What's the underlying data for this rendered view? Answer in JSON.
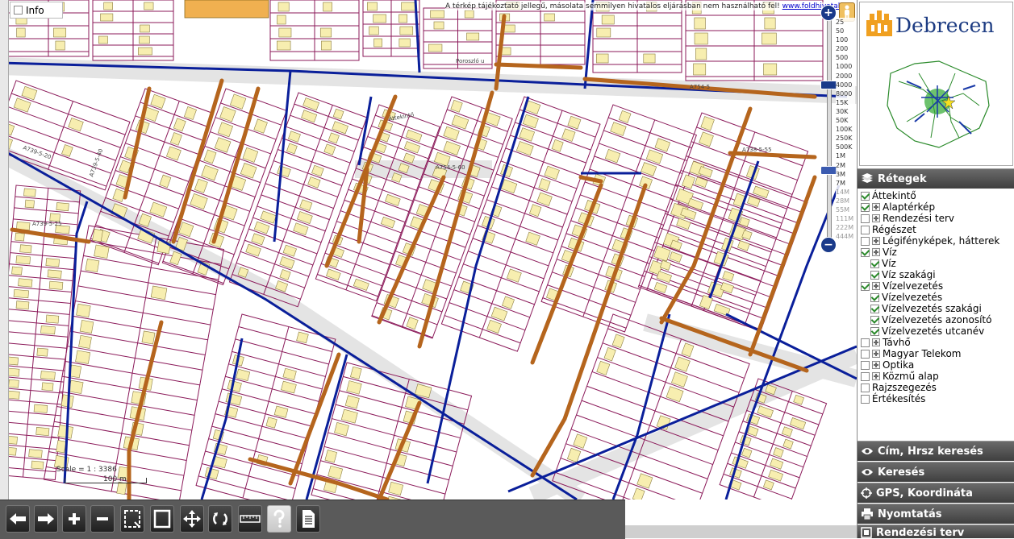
{
  "info": {
    "label": "Info",
    "checked": false
  },
  "disclaimer": {
    "text": "A térkép tájékoztató jellegű, másolata semmilyen hivatalos eljárásban nem használható fel!",
    "link": "www.foldhivatal.hu"
  },
  "zoom": {
    "plus": "+",
    "minus": "−"
  },
  "scales": [
    "25",
    "50",
    "100",
    "200",
    "500",
    "1000",
    "2000",
    "4000",
    "8000",
    "15K",
    "30K",
    "50K",
    "100K",
    "250K",
    "500K",
    "1M",
    "2M",
    "3M",
    "7M",
    "14M",
    "28M",
    "55M",
    "111M",
    "222M",
    "444M"
  ],
  "scale_bar": {
    "ratio": "Scale = 1 : 3386",
    "distance": "100 m"
  },
  "map_labels": [
    "Áttekintő",
    "Poroszló u",
    "A754-5",
    "A754-5-60",
    "A739-5-20",
    "A738-5-55",
    "A739-5-40",
    "A739-5-25"
  ],
  "toolbar": {
    "buttons": [
      "back-arrow-icon",
      "forward-arrow-icon",
      "zoom-in-icon",
      "zoom-out-icon",
      "zoom-box-icon",
      "full-extent-icon",
      "pan-icon",
      "refresh-icon",
      "measure-icon",
      "help-icon",
      "document-icon"
    ]
  },
  "logo": {
    "text": "Debrecen"
  },
  "panel": {
    "layers_header": "Rétegek",
    "address_search": "Cím, Hrsz keresés",
    "search": "Keresés",
    "gps": "GPS, Koordináta",
    "print": "Nyomtatás",
    "zoning": "Rendezési terv"
  },
  "layers": [
    {
      "label": "Áttekintő",
      "level": 0,
      "checkbox": true,
      "checked": true,
      "expand": false
    },
    {
      "label": "Alaptérkép",
      "level": 0,
      "checkbox": true,
      "checked": true,
      "expand": true
    },
    {
      "label": "Rendezési terv",
      "level": 0,
      "checkbox": true,
      "checked": false,
      "expand": true
    },
    {
      "label": "Régészet",
      "level": 0,
      "checkbox": true,
      "checked": false,
      "expand": false
    },
    {
      "label": "Légifényképek, hátterek",
      "level": 0,
      "checkbox": true,
      "checked": false,
      "expand": true
    },
    {
      "label": "Víz",
      "level": 0,
      "checkbox": true,
      "checked": true,
      "expand": true
    },
    {
      "label": "Víz",
      "level": 1,
      "checkbox": true,
      "checked": true,
      "expand": false
    },
    {
      "label": "Víz szakági",
      "level": 1,
      "checkbox": true,
      "checked": true,
      "expand": false
    },
    {
      "label": "Vízelvezetés",
      "level": 0,
      "checkbox": true,
      "checked": true,
      "expand": true
    },
    {
      "label": "Vízelvezetés",
      "level": 1,
      "checkbox": true,
      "checked": true,
      "expand": false
    },
    {
      "label": "Vízelvezetés szakági",
      "level": 1,
      "checkbox": true,
      "checked": true,
      "expand": false
    },
    {
      "label": "Vízelvezetés azonosító",
      "level": 1,
      "checkbox": true,
      "checked": true,
      "expand": false
    },
    {
      "label": "Vízelvezetés utcanév",
      "level": 1,
      "checkbox": true,
      "checked": true,
      "expand": false
    },
    {
      "label": "Távhő",
      "level": 0,
      "checkbox": true,
      "checked": false,
      "expand": true
    },
    {
      "label": "Magyar Telekom",
      "level": 0,
      "checkbox": true,
      "checked": false,
      "expand": true
    },
    {
      "label": "Optika",
      "level": 0,
      "checkbox": true,
      "checked": false,
      "expand": true
    },
    {
      "label": "Közmű alap",
      "level": 0,
      "checkbox": true,
      "checked": false,
      "expand": true
    },
    {
      "label": "Rajzszegezés",
      "level": 0,
      "checkbox": true,
      "checked": false,
      "expand": false
    },
    {
      "label": "Értékesítés",
      "level": 0,
      "checkbox": true,
      "checked": false,
      "expand": false
    }
  ],
  "colors": {
    "parcel": "#8b1a5a",
    "water": "#0a1f9a",
    "drainage": "#b5651d",
    "building": "#f7eeb0",
    "road": "#e4e4e4",
    "header": "#4a4a4a"
  }
}
